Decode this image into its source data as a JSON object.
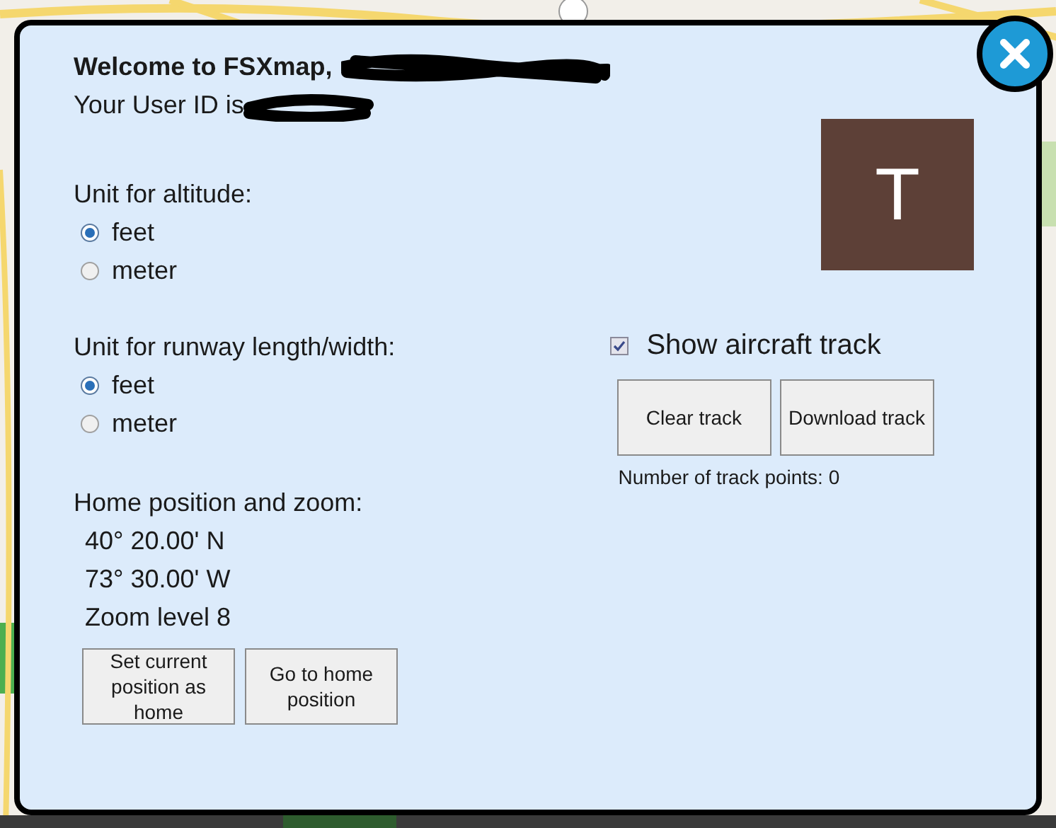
{
  "dialog": {
    "greeting": "Welcome to FSXmap,",
    "user_id_label": "Your User ID is",
    "avatar_letter": "T",
    "altitude_unit": {
      "label": "Unit for altitude:",
      "options": [
        {
          "label": "feet",
          "selected": true
        },
        {
          "label": "meter",
          "selected": false
        }
      ]
    },
    "runway_unit": {
      "label": "Unit for runway length/width:",
      "options": [
        {
          "label": "feet",
          "selected": true
        },
        {
          "label": "meter",
          "selected": false
        }
      ]
    },
    "home": {
      "label": "Home position and zoom:",
      "latitude": "40° 20.00' N",
      "longitude": "73° 30.00' W",
      "zoom": "Zoom level 8",
      "buttons": [
        "Set current position as home",
        "Go to home position"
      ]
    },
    "track": {
      "show_track": {
        "label": "Show aircraft track",
        "checked": true
      },
      "buttons": [
        "Clear track",
        "Download track"
      ],
      "points": "Number of track points: 0"
    }
  }
}
